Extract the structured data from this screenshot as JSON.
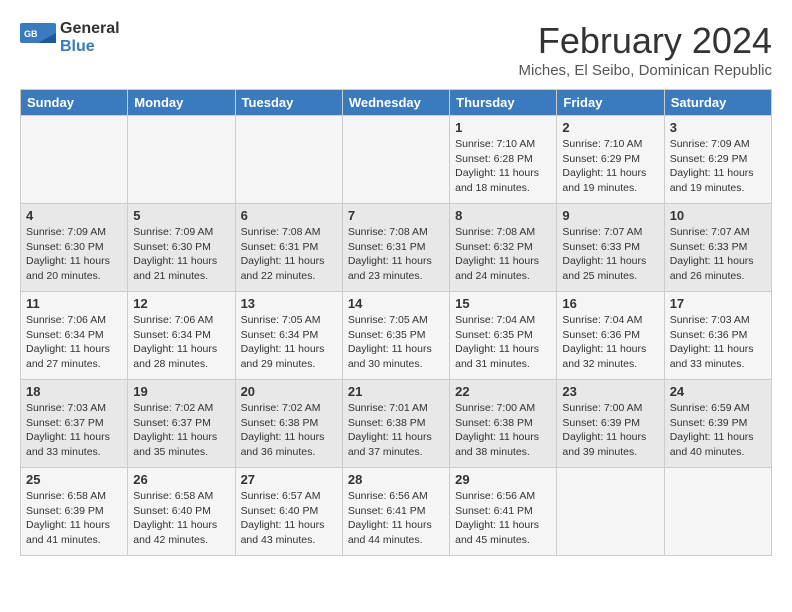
{
  "logo": {
    "text_general": "General",
    "text_blue": "Blue"
  },
  "title": {
    "month_year": "February 2024",
    "location": "Miches, El Seibo, Dominican Republic"
  },
  "headers": [
    "Sunday",
    "Monday",
    "Tuesday",
    "Wednesday",
    "Thursday",
    "Friday",
    "Saturday"
  ],
  "weeks": [
    [
      {
        "day": "",
        "content": ""
      },
      {
        "day": "",
        "content": ""
      },
      {
        "day": "",
        "content": ""
      },
      {
        "day": "",
        "content": ""
      },
      {
        "day": "1",
        "content": "Sunrise: 7:10 AM\nSunset: 6:28 PM\nDaylight: 11 hours\nand 18 minutes."
      },
      {
        "day": "2",
        "content": "Sunrise: 7:10 AM\nSunset: 6:29 PM\nDaylight: 11 hours\nand 19 minutes."
      },
      {
        "day": "3",
        "content": "Sunrise: 7:09 AM\nSunset: 6:29 PM\nDaylight: 11 hours\nand 19 minutes."
      }
    ],
    [
      {
        "day": "4",
        "content": "Sunrise: 7:09 AM\nSunset: 6:30 PM\nDaylight: 11 hours\nand 20 minutes."
      },
      {
        "day": "5",
        "content": "Sunrise: 7:09 AM\nSunset: 6:30 PM\nDaylight: 11 hours\nand 21 minutes."
      },
      {
        "day": "6",
        "content": "Sunrise: 7:08 AM\nSunset: 6:31 PM\nDaylight: 11 hours\nand 22 minutes."
      },
      {
        "day": "7",
        "content": "Sunrise: 7:08 AM\nSunset: 6:31 PM\nDaylight: 11 hours\nand 23 minutes."
      },
      {
        "day": "8",
        "content": "Sunrise: 7:08 AM\nSunset: 6:32 PM\nDaylight: 11 hours\nand 24 minutes."
      },
      {
        "day": "9",
        "content": "Sunrise: 7:07 AM\nSunset: 6:33 PM\nDaylight: 11 hours\nand 25 minutes."
      },
      {
        "day": "10",
        "content": "Sunrise: 7:07 AM\nSunset: 6:33 PM\nDaylight: 11 hours\nand 26 minutes."
      }
    ],
    [
      {
        "day": "11",
        "content": "Sunrise: 7:06 AM\nSunset: 6:34 PM\nDaylight: 11 hours\nand 27 minutes."
      },
      {
        "day": "12",
        "content": "Sunrise: 7:06 AM\nSunset: 6:34 PM\nDaylight: 11 hours\nand 28 minutes."
      },
      {
        "day": "13",
        "content": "Sunrise: 7:05 AM\nSunset: 6:34 PM\nDaylight: 11 hours\nand 29 minutes."
      },
      {
        "day": "14",
        "content": "Sunrise: 7:05 AM\nSunset: 6:35 PM\nDaylight: 11 hours\nand 30 minutes."
      },
      {
        "day": "15",
        "content": "Sunrise: 7:04 AM\nSunset: 6:35 PM\nDaylight: 11 hours\nand 31 minutes."
      },
      {
        "day": "16",
        "content": "Sunrise: 7:04 AM\nSunset: 6:36 PM\nDaylight: 11 hours\nand 32 minutes."
      },
      {
        "day": "17",
        "content": "Sunrise: 7:03 AM\nSunset: 6:36 PM\nDaylight: 11 hours\nand 33 minutes."
      }
    ],
    [
      {
        "day": "18",
        "content": "Sunrise: 7:03 AM\nSunset: 6:37 PM\nDaylight: 11 hours\nand 33 minutes."
      },
      {
        "day": "19",
        "content": "Sunrise: 7:02 AM\nSunset: 6:37 PM\nDaylight: 11 hours\nand 35 minutes."
      },
      {
        "day": "20",
        "content": "Sunrise: 7:02 AM\nSunset: 6:38 PM\nDaylight: 11 hours\nand 36 minutes."
      },
      {
        "day": "21",
        "content": "Sunrise: 7:01 AM\nSunset: 6:38 PM\nDaylight: 11 hours\nand 37 minutes."
      },
      {
        "day": "22",
        "content": "Sunrise: 7:00 AM\nSunset: 6:38 PM\nDaylight: 11 hours\nand 38 minutes."
      },
      {
        "day": "23",
        "content": "Sunrise: 7:00 AM\nSunset: 6:39 PM\nDaylight: 11 hours\nand 39 minutes."
      },
      {
        "day": "24",
        "content": "Sunrise: 6:59 AM\nSunset: 6:39 PM\nDaylight: 11 hours\nand 40 minutes."
      }
    ],
    [
      {
        "day": "25",
        "content": "Sunrise: 6:58 AM\nSunset: 6:39 PM\nDaylight: 11 hours\nand 41 minutes."
      },
      {
        "day": "26",
        "content": "Sunrise: 6:58 AM\nSunset: 6:40 PM\nDaylight: 11 hours\nand 42 minutes."
      },
      {
        "day": "27",
        "content": "Sunrise: 6:57 AM\nSunset: 6:40 PM\nDaylight: 11 hours\nand 43 minutes."
      },
      {
        "day": "28",
        "content": "Sunrise: 6:56 AM\nSunset: 6:41 PM\nDaylight: 11 hours\nand 44 minutes."
      },
      {
        "day": "29",
        "content": "Sunrise: 6:56 AM\nSunset: 6:41 PM\nDaylight: 11 hours\nand 45 minutes."
      },
      {
        "day": "",
        "content": ""
      },
      {
        "day": "",
        "content": ""
      }
    ]
  ]
}
